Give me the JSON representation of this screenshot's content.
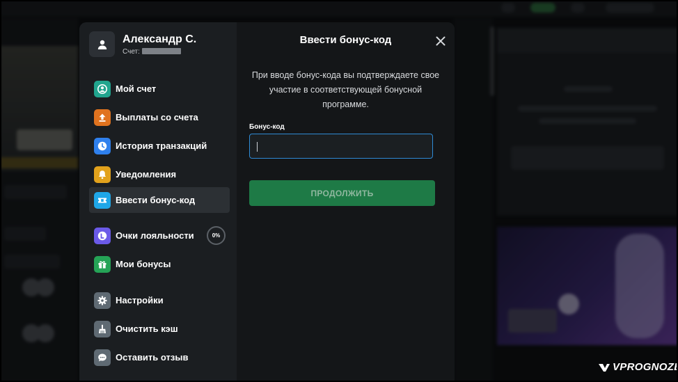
{
  "user": {
    "name": "Александр С.",
    "account_label": "Счет:"
  },
  "menu": [
    {
      "label": "Мой счет",
      "icon": "user-circle-icon",
      "color": "#21a58e"
    },
    {
      "label": "Выплаты со счета",
      "icon": "upload-icon",
      "color": "#e0731f"
    },
    {
      "label": "История транзакций",
      "icon": "clock-icon",
      "color": "#2f80ed"
    },
    {
      "label": "Уведомления",
      "icon": "bell-icon",
      "color": "#e2a21c"
    },
    {
      "label": "Ввести бонус-код",
      "icon": "ticket-icon",
      "color": "#1fa7e8",
      "active": true
    },
    {
      "label": "Очки лояльности",
      "icon": "loyalty-icon",
      "color": "#6b5ae8",
      "badge": "0%"
    },
    {
      "label": "Мои бонусы",
      "icon": "gift-icon",
      "color": "#25a356"
    },
    {
      "label": "Настройки",
      "icon": "gear-icon",
      "color": "#5f6a73"
    },
    {
      "label": "Очистить кэш",
      "icon": "broom-icon",
      "color": "#5f6a73"
    },
    {
      "label": "Оставить отзыв",
      "icon": "chat-icon",
      "color": "#5f6a73"
    }
  ],
  "dialog": {
    "title": "Ввести бонус-код",
    "description": "При вводе бонус-кода вы подтверждаете свое участие в соответствующей бонусной программе.",
    "field_label": "Бонус-код",
    "field_value": "",
    "submit_label": "ПРОДОЛЖИТЬ"
  },
  "watermark": "VPROGNOZE",
  "colors": {
    "accent_green": "#1e7a46",
    "input_border": "#2f8bd6",
    "modal_bg": "#1b1e21"
  }
}
